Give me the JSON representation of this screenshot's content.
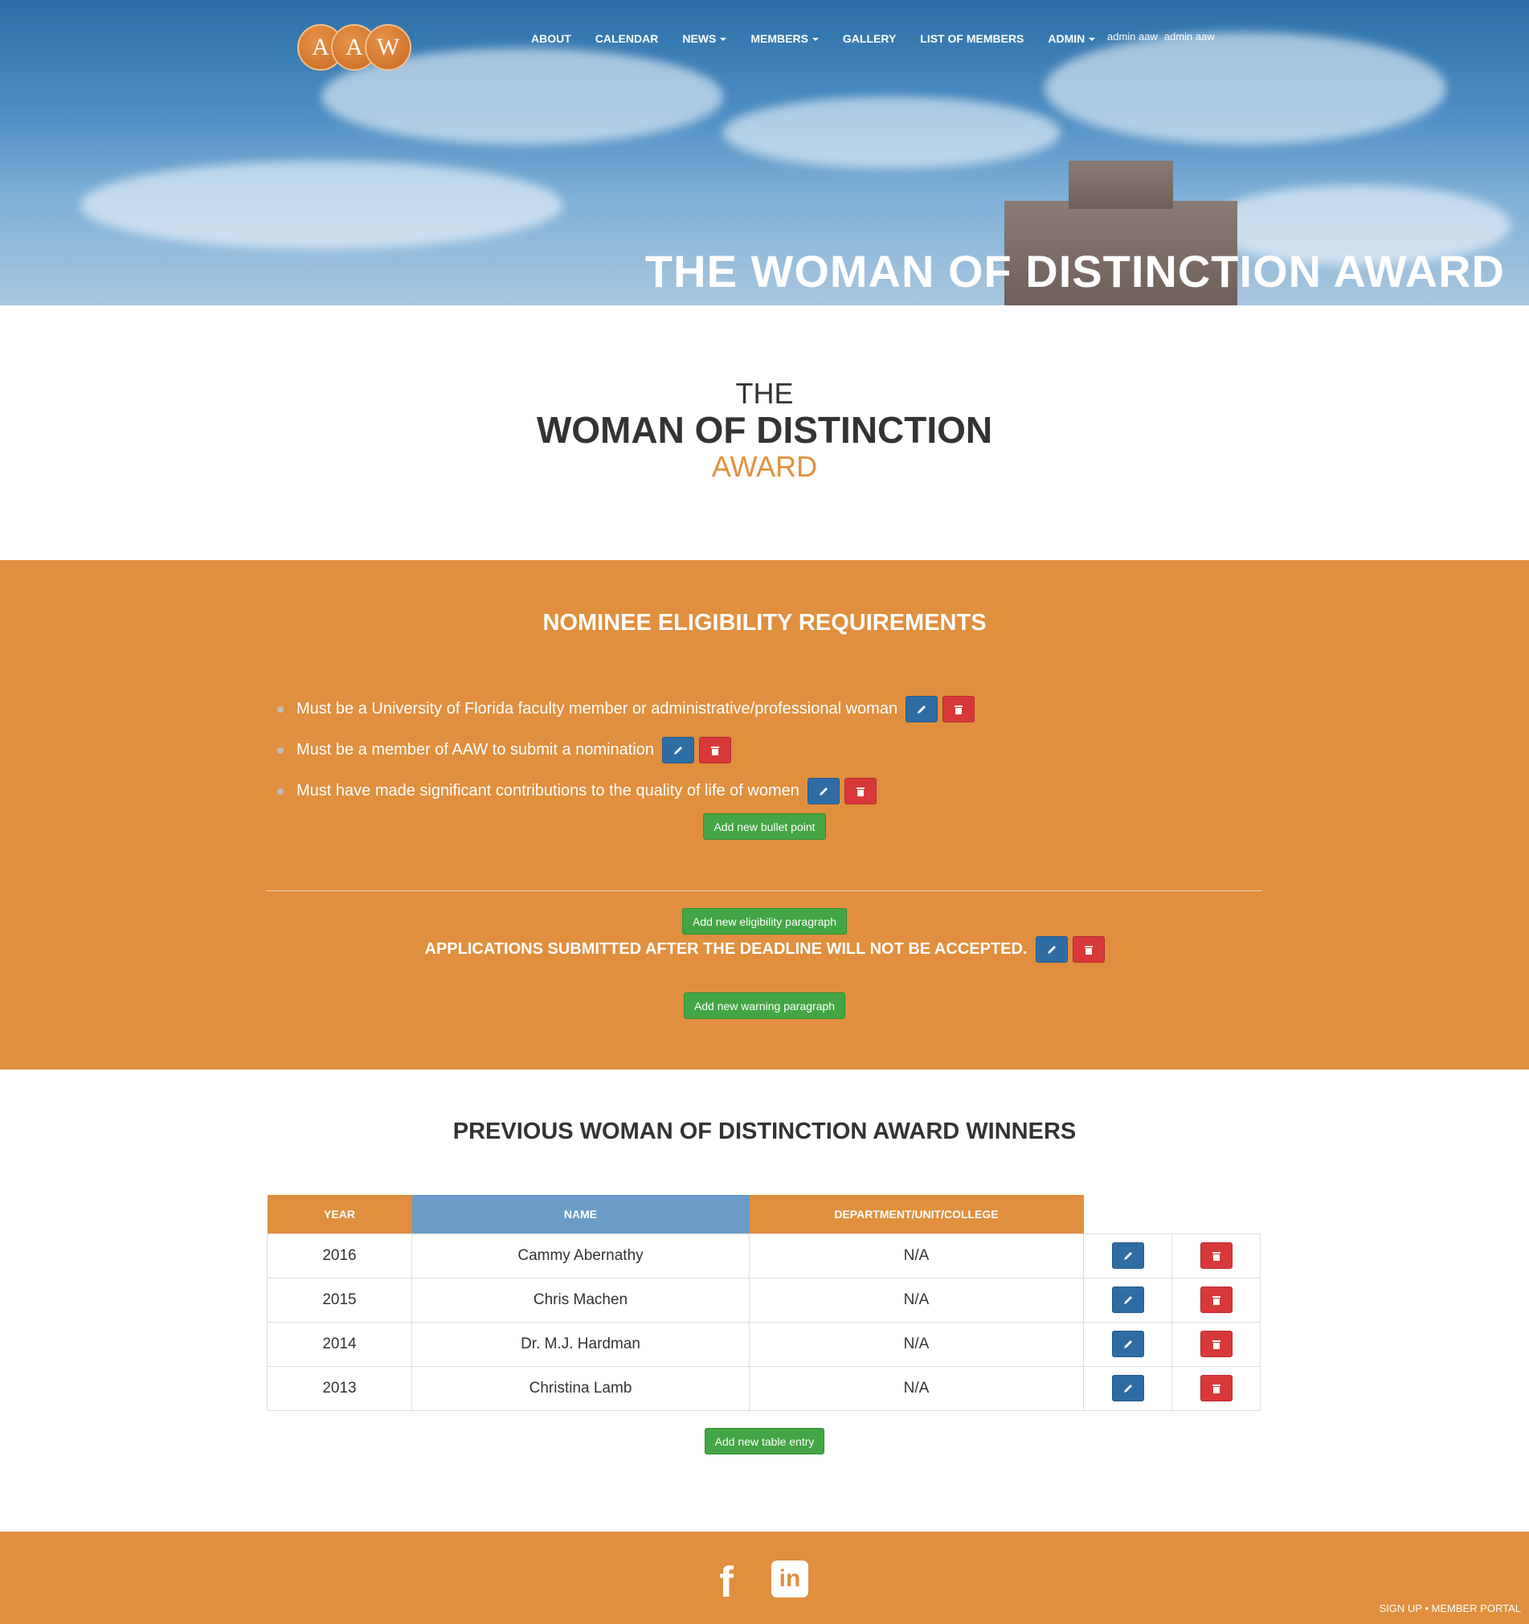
{
  "header": {
    "logo_letters": [
      "A",
      "A",
      "W"
    ],
    "nav": [
      {
        "label": "ABOUT",
        "dropdown": false
      },
      {
        "label": "CALENDAR",
        "dropdown": false
      },
      {
        "label": "NEWS",
        "dropdown": true
      },
      {
        "label": "MEMBERS",
        "dropdown": true
      },
      {
        "label": "GALLERY",
        "dropdown": false
      },
      {
        "label": "LIST OF MEMBERS",
        "dropdown": false
      },
      {
        "label": "ADMIN",
        "dropdown": true
      }
    ],
    "user_small": "admin aaw",
    "user_menu": "admin aaw",
    "hero_title": "THE WOMAN OF DISTINCTION AWARD"
  },
  "intro": {
    "line1": "THE",
    "line2": "WOMAN OF DISTINCTION",
    "line3": "AWARD"
  },
  "eligibility": {
    "heading": "NOMINEE ELIGIBILITY REQUIREMENTS",
    "bullets": [
      "Must be a University of Florida faculty member or administrative/professional woman",
      "Must be a member of AAW to submit a nomination",
      "Must have made significant contributions to the quality of life of women"
    ],
    "add_bullet_label": "Add new bullet point",
    "add_paragraph_label": "Add new eligibility paragraph",
    "warning": "APPLICATIONS SUBMITTED AFTER THE DEADLINE WILL NOT BE ACCEPTED.",
    "add_warning_label": "Add new warning paragraph"
  },
  "winners": {
    "heading": "PREVIOUS WOMAN OF DISTINCTION AWARD WINNERS",
    "columns": [
      "YEAR",
      "NAME",
      "DEPARTMENT/UNIT/COLLEGE"
    ],
    "rows": [
      {
        "year": "2016",
        "name": "Cammy Abernathy",
        "dept": "N/A"
      },
      {
        "year": "2015",
        "name": "Chris Machen",
        "dept": "N/A"
      },
      {
        "year": "2014",
        "name": "Dr. M.J. Hardman",
        "dept": "N/A"
      },
      {
        "year": "2013",
        "name": "Christina Lamb",
        "dept": "N/A"
      }
    ],
    "add_entry_label": "Add new table entry"
  },
  "footer": {
    "facebook_icon": "facebook-icon",
    "linkedin_icon": "linkedin-icon",
    "links_text": "SIGN UP • MEMBER PORTAL"
  },
  "colors": {
    "orange": "#e08f3e",
    "blue_header": "#6a9cc7",
    "edit_blue": "#2e6da4",
    "delete_red": "#d9383a",
    "add_green": "#43a543"
  }
}
